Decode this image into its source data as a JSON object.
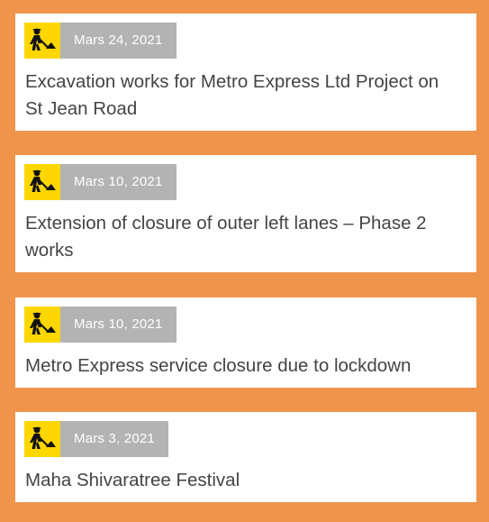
{
  "colors": {
    "background": "#EF944B",
    "card": "#FFFFFF",
    "icon_background": "#FFD700",
    "date_badge": "#B3B3B3",
    "title_text": "#444444"
  },
  "news": [
    {
      "icon": "road-works-icon",
      "date": "Mars 24, 2021",
      "title": "Excavation works for Metro Express Ltd Project on St Jean Road"
    },
    {
      "icon": "road-works-icon",
      "date": "Mars 10, 2021",
      "title": "Extension of closure of outer left lanes – Phase 2 works"
    },
    {
      "icon": "road-works-icon",
      "date": "Mars 10, 2021",
      "title": "Metro Express service closure due to lockdown"
    },
    {
      "icon": "road-works-icon",
      "date": "Mars 3, 2021",
      "title": "Maha Shivaratree Festival"
    }
  ]
}
